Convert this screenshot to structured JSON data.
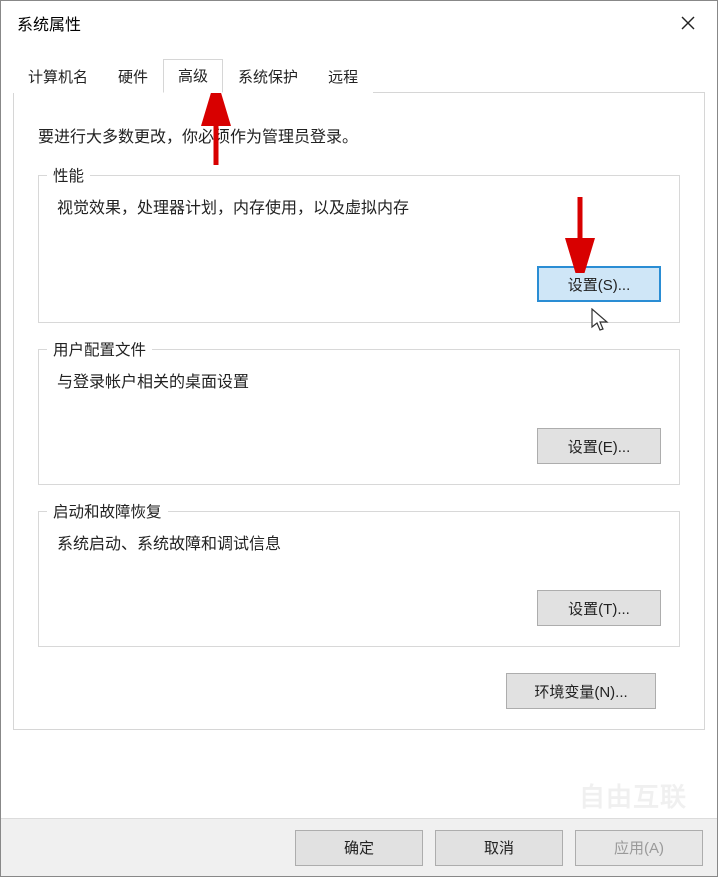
{
  "window": {
    "title": "系统属性"
  },
  "tabs": [
    {
      "label": "计算机名",
      "active": false
    },
    {
      "label": "硬件",
      "active": false
    },
    {
      "label": "高级",
      "active": true
    },
    {
      "label": "系统保护",
      "active": false
    },
    {
      "label": "远程",
      "active": false
    }
  ],
  "intro": "要进行大多数更改，你必须作为管理员登录。",
  "sections": {
    "performance": {
      "legend": "性能",
      "desc": "视觉效果，处理器计划，内存使用，以及虚拟内存",
      "button": "设置(S)..."
    },
    "profiles": {
      "legend": "用户配置文件",
      "desc": "与登录帐户相关的桌面设置",
      "button": "设置(E)..."
    },
    "startup": {
      "legend": "启动和故障恢复",
      "desc": "系统启动、系统故障和调试信息",
      "button": "设置(T)..."
    }
  },
  "envButton": "环境变量(N)...",
  "bottom": {
    "ok": "确定",
    "cancel": "取消",
    "apply": "应用(A)"
  },
  "watermark": "自由互联"
}
